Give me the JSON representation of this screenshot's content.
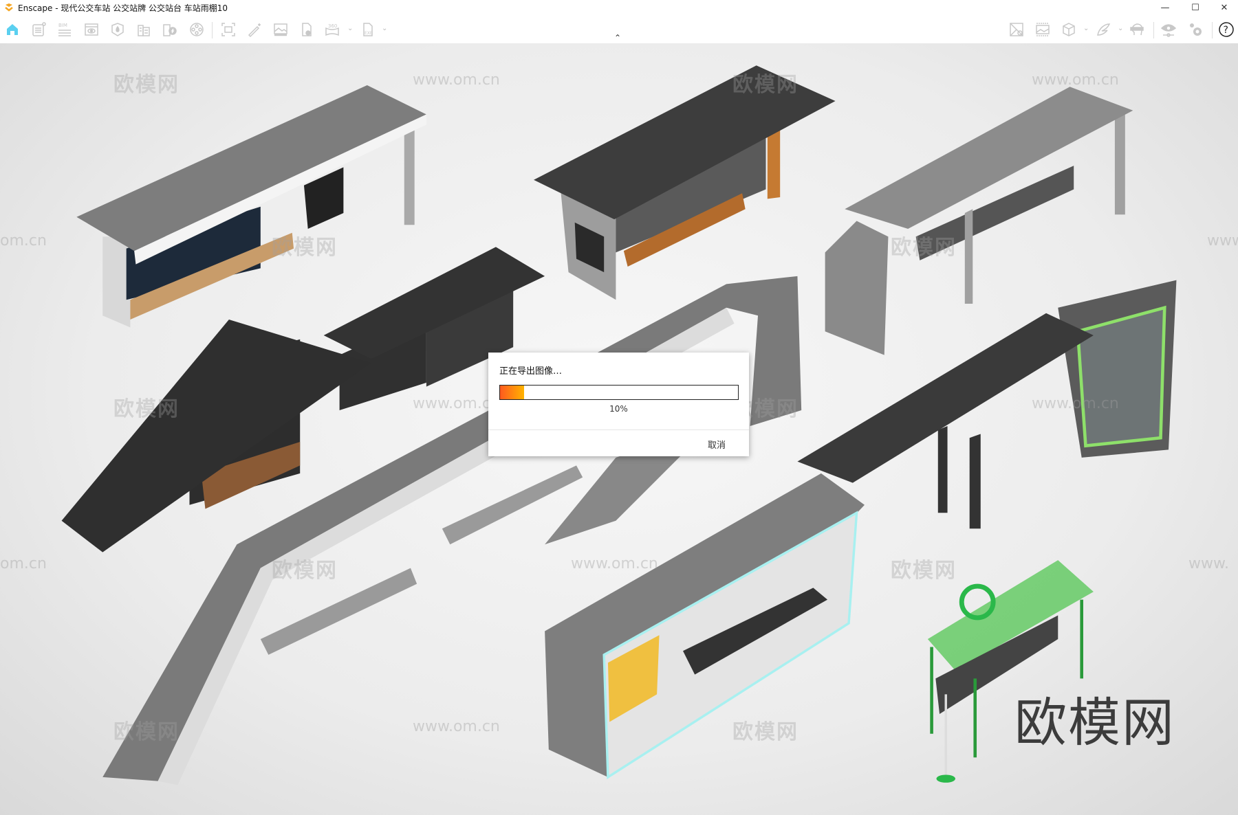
{
  "window": {
    "app": "Enscape",
    "title": "Enscape - 现代公交车站 公交站牌 公交站台 车站雨棚10",
    "minimize": "—",
    "maximize": "☐",
    "close": "✕"
  },
  "toolbar": {
    "left_icons": [
      "home-icon",
      "notes-icon",
      "bim-icon",
      "view-icon",
      "site-context-icon",
      "buildings-icon",
      "energy-icon",
      "video-icon",
      "screenshot-icon",
      "magic-wand-icon",
      "image-icon",
      "export-file-icon",
      "panorama-360-icon",
      "export-exe-icon"
    ],
    "right_icons": [
      "map-pin-icon",
      "batch-image-icon",
      "cube-icon",
      "wing-icon",
      "vr-headset-icon",
      "visual-settings-icon",
      "settings-gears-icon",
      "help-icon"
    ],
    "bim_label": "BIM",
    "pano_label": "360",
    "exe_label": "EXE",
    "help": "?",
    "collapse": "⌃"
  },
  "dialog": {
    "title": "正在导出图像…",
    "progress_percent": 10,
    "progress_label": "10%",
    "cancel": "取消",
    "colors": {
      "start": "#ff5a1f",
      "end": "#ffb300"
    }
  },
  "watermarks": {
    "cn": "欧模网",
    "url": "www.om.cn",
    "partial_url": "om.cn",
    "partial_url2": "www.",
    "big": "欧模网"
  }
}
